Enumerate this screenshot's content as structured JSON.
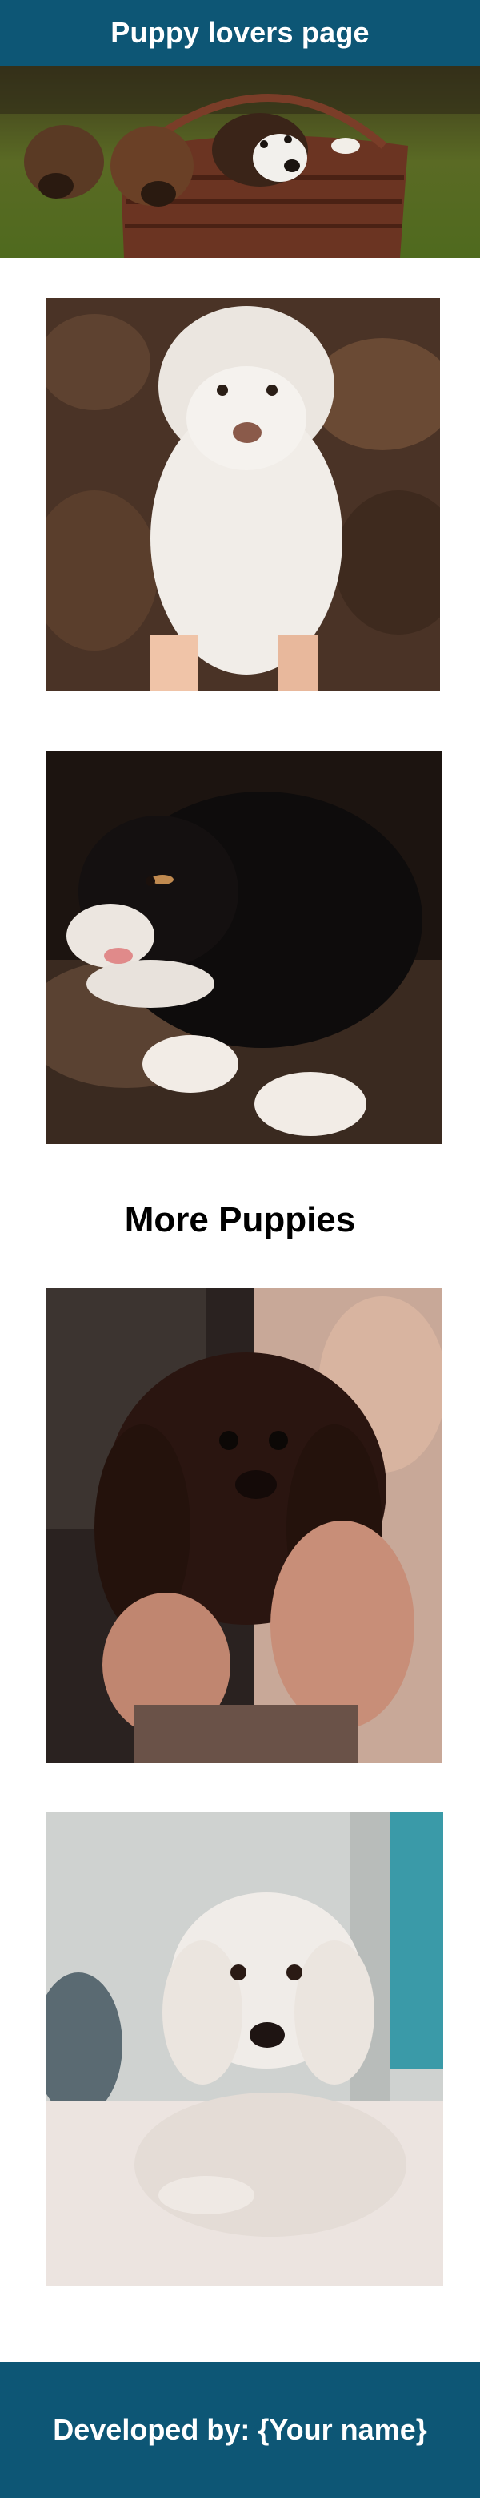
{
  "header": {
    "title": "Puppy lovers page"
  },
  "section": {
    "title": "More Puppies"
  },
  "footer": {
    "text": "Developed by: {Your name}"
  },
  "colors": {
    "header_bg": "#0d5675",
    "footer_bg": "#0d5675",
    "text_light": "#ffffff"
  },
  "images": [
    {
      "name": "hero-puppies-basket-image",
      "description": "three puppies in a wicker basket on grass"
    },
    {
      "name": "white-puppy-image",
      "description": "fluffy white puppy held up in front of a woodpile"
    },
    {
      "name": "black-puppy-image",
      "description": "black and white puppy lying on a brown blanket"
    },
    {
      "name": "brown-puppy-image",
      "description": "dark brown spaniel puppy held in hands"
    },
    {
      "name": "white-poodle-image",
      "description": "white poodle lying on carpet"
    }
  ]
}
